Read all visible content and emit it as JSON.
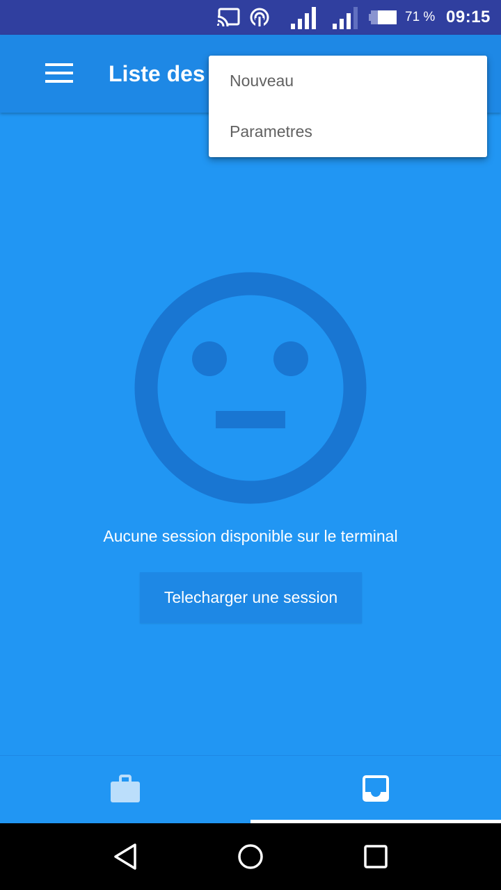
{
  "status_bar": {
    "battery_percent": "71 %",
    "time": "09:15",
    "icons": [
      "cast-icon",
      "hotspot-icon",
      "signal-icon",
      "signal-icon",
      "battery-icon"
    ]
  },
  "app_bar": {
    "menu_icon": "hamburger-menu-icon",
    "title": "Liste des sessions"
  },
  "overflow_menu": {
    "items": [
      {
        "label": "Nouveau"
      },
      {
        "label": "Parametres"
      }
    ]
  },
  "empty_state": {
    "icon": "neutral-face-icon",
    "message": "Aucune session disponible sur le terminal",
    "button_label": "Telecharger une session"
  },
  "bottom_tabs": {
    "items": [
      {
        "icon": "briefcase-icon",
        "selected": false
      },
      {
        "icon": "inbox-icon",
        "selected": true
      }
    ]
  },
  "nav_bar": {
    "buttons": [
      "back-icon",
      "home-icon",
      "recents-icon"
    ]
  },
  "colors": {
    "status_bar": "#303F9F",
    "app_bar": "#1E88E5",
    "background": "#2196F3",
    "face": "#1976D2"
  }
}
